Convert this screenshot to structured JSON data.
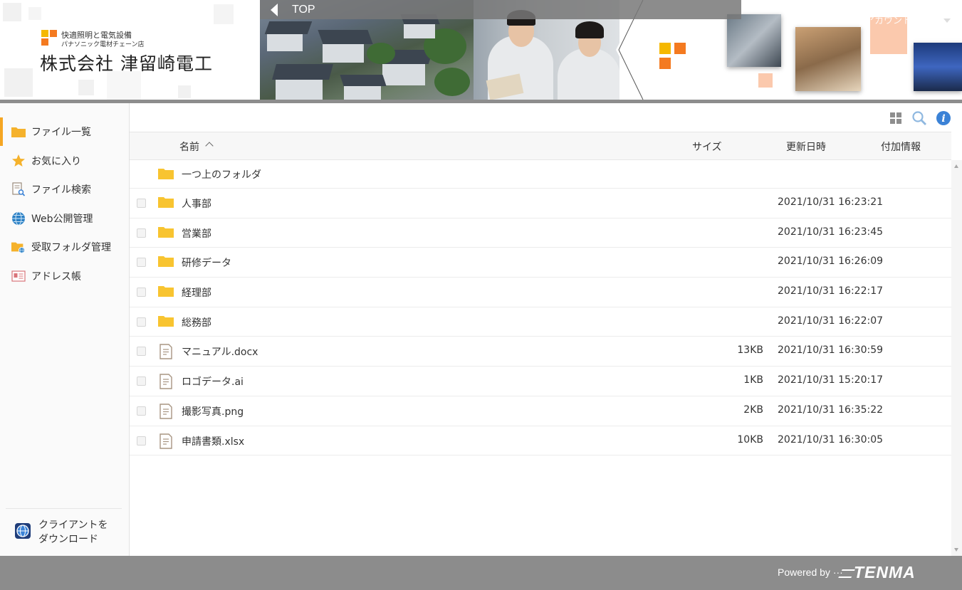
{
  "header": {
    "tagline_line1": "快適照明と電気設備",
    "tagline_line2": "パナソニック電材チェーン店",
    "company_name": "株式会社 津留崎電工",
    "top_label": "TOP",
    "account_label": "アカウント"
  },
  "colors": {
    "accent_orange": "#f47a20",
    "accent_yellow": "#f5b800",
    "folder_yellow": "#f8c430",
    "sidebar_active": "#f5a623",
    "footer_gray": "#8c8c8c",
    "info_blue": "#3b82d6"
  },
  "sidebar": {
    "items": [
      {
        "label": "ファイル一覧",
        "icon": "folder-icon",
        "active": true
      },
      {
        "label": "お気に入り",
        "icon": "star-icon",
        "active": false
      },
      {
        "label": "ファイル検索",
        "icon": "file-search-icon",
        "active": false
      },
      {
        "label": "Web公開管理",
        "icon": "globe-icon",
        "active": false
      },
      {
        "label": "受取フォルダ管理",
        "icon": "folder-globe-icon",
        "active": false
      },
      {
        "label": "アドレス帳",
        "icon": "address-card-icon",
        "active": false
      }
    ],
    "download_line1": "クライアントを",
    "download_line2": "ダウンロード"
  },
  "toolbar": {
    "icons": [
      "grid-view-icon",
      "search-icon",
      "info-icon"
    ]
  },
  "table": {
    "columns": {
      "name": "名前",
      "size": "サイズ",
      "modified": "更新日時",
      "extra": "付加情報"
    },
    "parent_folder": "一つ上のフォルダ",
    "rows": [
      {
        "type": "folder",
        "name": "人事部",
        "size": "",
        "modified": "2021/10/31 16:23:21"
      },
      {
        "type": "folder",
        "name": "営業部",
        "size": "",
        "modified": "2021/10/31 16:23:45"
      },
      {
        "type": "folder",
        "name": "研修データ",
        "size": "",
        "modified": "2021/10/31 16:26:09"
      },
      {
        "type": "folder",
        "name": "経理部",
        "size": "",
        "modified": "2021/10/31 16:22:17"
      },
      {
        "type": "folder",
        "name": "総務部",
        "size": "",
        "modified": "2021/10/31 16:22:07"
      },
      {
        "type": "file",
        "name": "マニュアル.docx",
        "size": "13KB",
        "modified": "2021/10/31 16:30:59"
      },
      {
        "type": "file",
        "name": "ロゴデータ.ai",
        "size": "1KB",
        "modified": "2021/10/31 15:20:17"
      },
      {
        "type": "file",
        "name": "撮影写真.png",
        "size": "2KB",
        "modified": "2021/10/31 16:35:22"
      },
      {
        "type": "file",
        "name": "申請書類.xlsx",
        "size": "10KB",
        "modified": "2021/10/31 16:30:05"
      }
    ]
  },
  "footer": {
    "powered_by": "Powered by ···",
    "brand": "TENMA"
  }
}
